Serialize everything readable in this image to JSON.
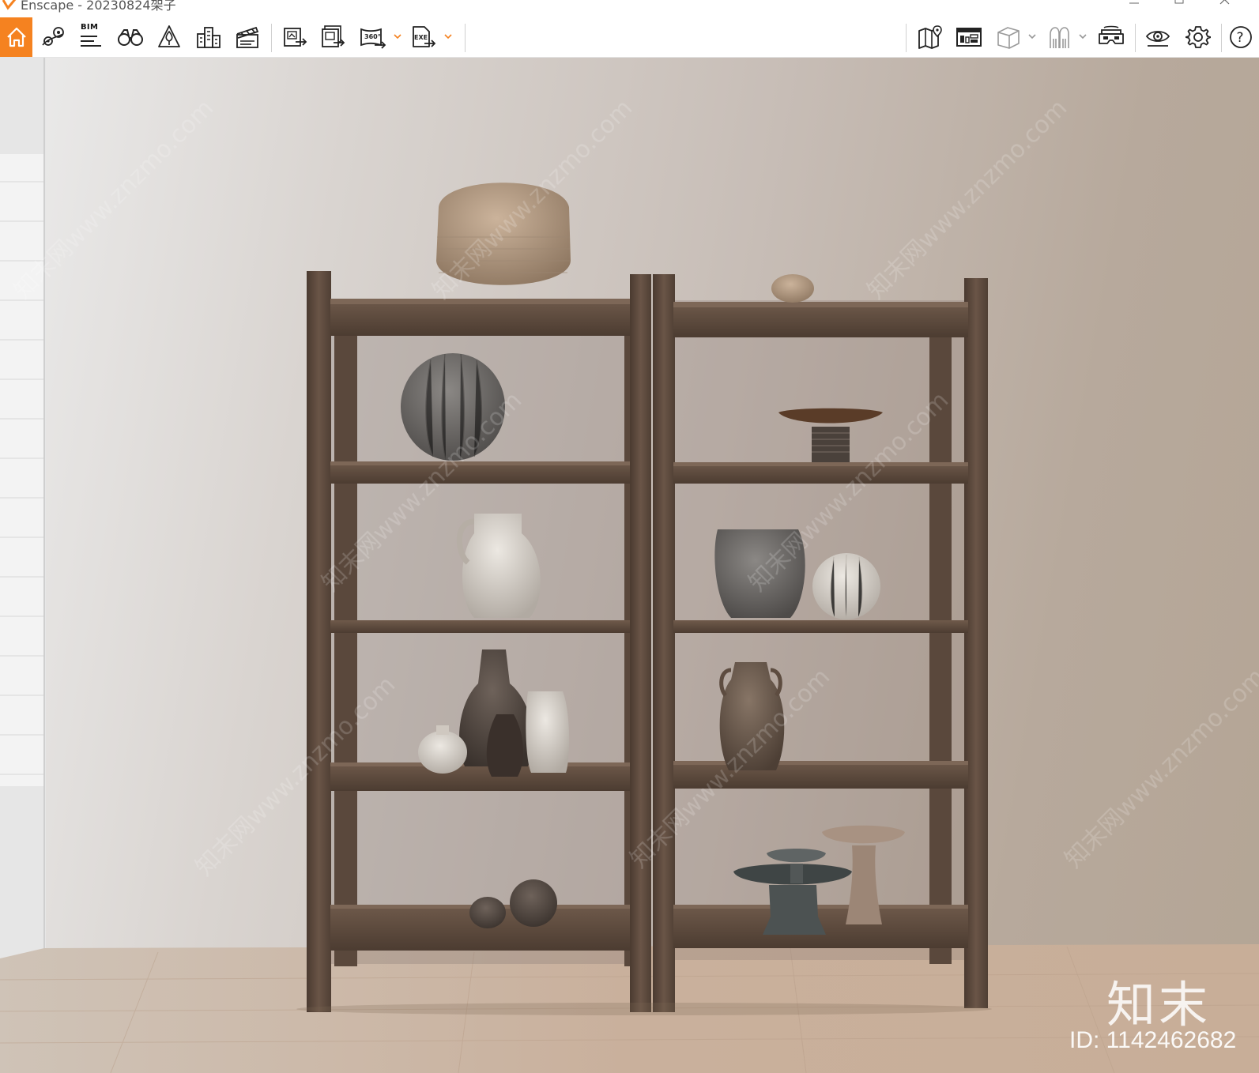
{
  "window": {
    "title": "Enscape - 20230824架子",
    "accent_color": "#f58220",
    "controls": [
      "minimize-icon",
      "maximize-icon",
      "close-icon"
    ]
  },
  "toolbar": {
    "left_tools": [
      {
        "name": "home",
        "icon": "home-icon"
      },
      {
        "name": "view-management",
        "icon": "location-pin-icon"
      },
      {
        "name": "bim",
        "label": "BIM",
        "icon": "bim-list-icon"
      },
      {
        "name": "walk-mode",
        "icon": "binoculars-icon"
      },
      {
        "name": "asset-library",
        "icon": "asset-tree-icon"
      },
      {
        "name": "site-context",
        "icon": "buildings-icon"
      },
      {
        "name": "video-editor",
        "icon": "clapper-icon"
      },
      {
        "name": "batch-render",
        "icon": "batch-render-icon"
      },
      {
        "name": "export-image",
        "icon": "export-image-icon"
      },
      {
        "name": "panorama",
        "label": "360°",
        "icon": "panorama-icon"
      },
      {
        "name": "export-exe",
        "label": "EXE",
        "icon": "export-exe-icon"
      }
    ],
    "right_tools": [
      {
        "name": "map",
        "icon": "map-pin-icon"
      },
      {
        "name": "material-editor",
        "icon": "dashboard-icon"
      },
      {
        "name": "section",
        "icon": "cube-icon"
      },
      {
        "name": "people",
        "icon": "people-icon"
      },
      {
        "name": "vr",
        "icon": "vr-headset-icon"
      },
      {
        "name": "visual-settings",
        "icon": "eye-icon"
      },
      {
        "name": "settings",
        "icon": "gear-icon"
      },
      {
        "name": "help",
        "label": "?",
        "icon": "help-icon"
      }
    ],
    "collapse_icon": "chevron-up-icon"
  },
  "viewport": {
    "watermark_logo": "知末",
    "watermark_id": "ID: 1142462682",
    "watermark_text": "知末网www.znzmo.com"
  }
}
